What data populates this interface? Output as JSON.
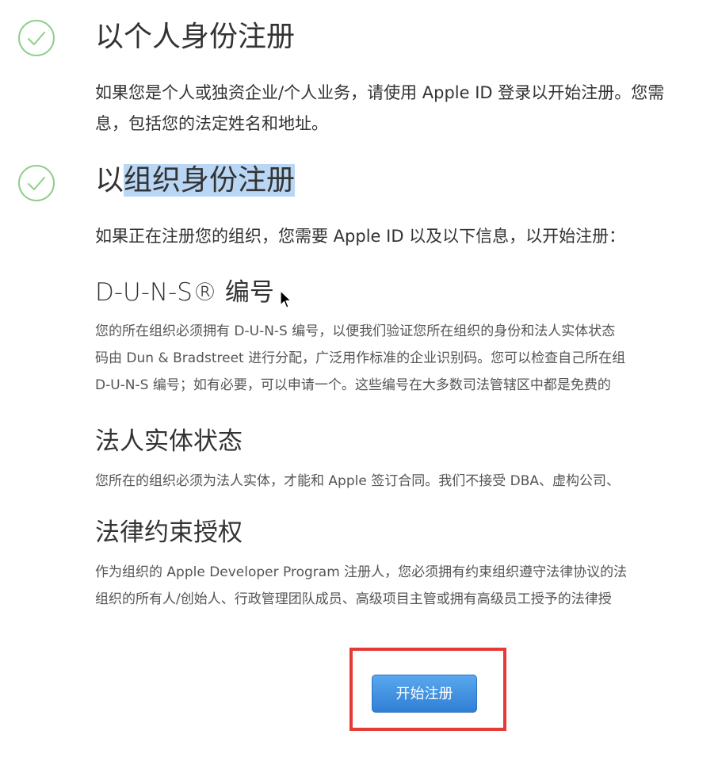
{
  "individual": {
    "icon": "check-circle-icon",
    "title": "以个人身份注册",
    "description_lines": [
      "如果您是个人或独资企业/个人业务，请使用 Apple ID 登录以开始注册。您需",
      "息，包括您的法定姓名和地址。"
    ]
  },
  "organization": {
    "icon": "check-circle-icon",
    "title_prefix": "以",
    "title_highlighted": "组织身份注册",
    "intro": "如果正在注册您的组织，您需要 Apple ID 以及以下信息，以开始注册：",
    "duns": {
      "title": "D-U-N-S® 编号",
      "lines": [
        "您的所在组织必须拥有 D-U-N-S 编号，以便我们验证您所在组织的身份和法人实体状态",
        "码由 Dun & Bradstreet 进行分配，广泛用作标准的企业识别码。您可以检查自己所在组",
        "D-U-N-S 编号；如有必要，可以申请一个。这些编号在大多数司法管辖区中都是免费的"
      ]
    },
    "legal_entity": {
      "title": "法人实体状态",
      "lines": [
        "您所在的组织必须为法人实体，才能和 Apple 签订合同。我们不接受 DBA、虚构公司、"
      ]
    },
    "legal_authority": {
      "title": "法律约束授权",
      "lines": [
        "作为组织的 Apple Developer Program 注册人，您必须拥有约束组织遵守法律协议的法",
        "组织的所有人/创始人、行政管理团队成员、高级项目主管或拥有高级员工授予的法律授"
      ]
    }
  },
  "cta": {
    "label": "开始注册"
  },
  "colors": {
    "check_green": "#8fcf8a",
    "selection": "#b9d7f5",
    "button_blue": "#3a8be0",
    "highlight_red": "#e53a35"
  }
}
